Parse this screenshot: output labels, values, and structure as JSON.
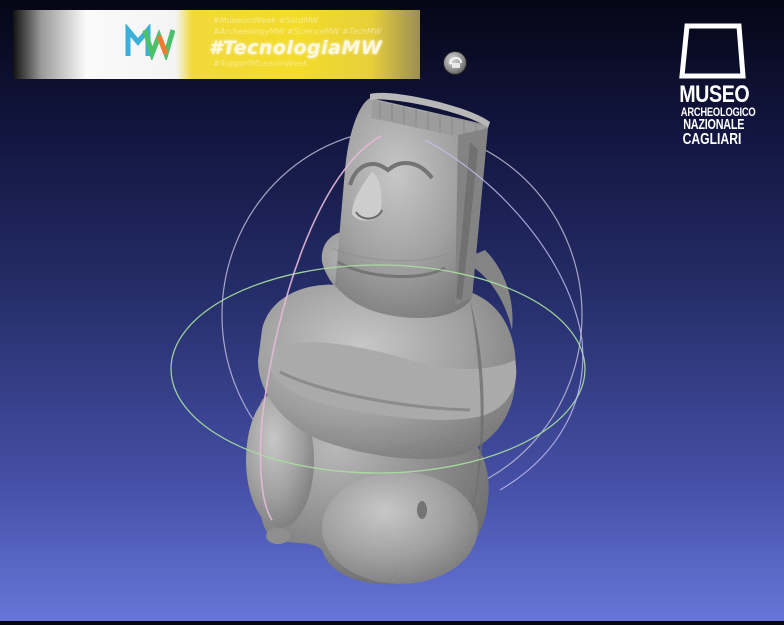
{
  "banner": {
    "hashtag": "#TecnologiaMW",
    "faded_line_1": "#MuseumWeek #SardMW",
    "faded_line_2": "#ArchaeologyMW #ScienceMW #TechMW",
    "faded_line_3": "#SupportMuseumWeek",
    "logo_icon": "museumweek-logo"
  },
  "viewer": {
    "reset_icon": "reset-view-icon",
    "model_description": "3D model of a seated female figurine",
    "trackball_colors": {
      "horizontal": "#a8e0a0",
      "vertical": "#e8b8d8",
      "diagonal": "#c8c0f8"
    }
  },
  "museum": {
    "line1": "MUSEO",
    "line2": "ARCHEOLOGICO",
    "line3": "NAZIONALE",
    "line4": "CAGLIARI"
  }
}
